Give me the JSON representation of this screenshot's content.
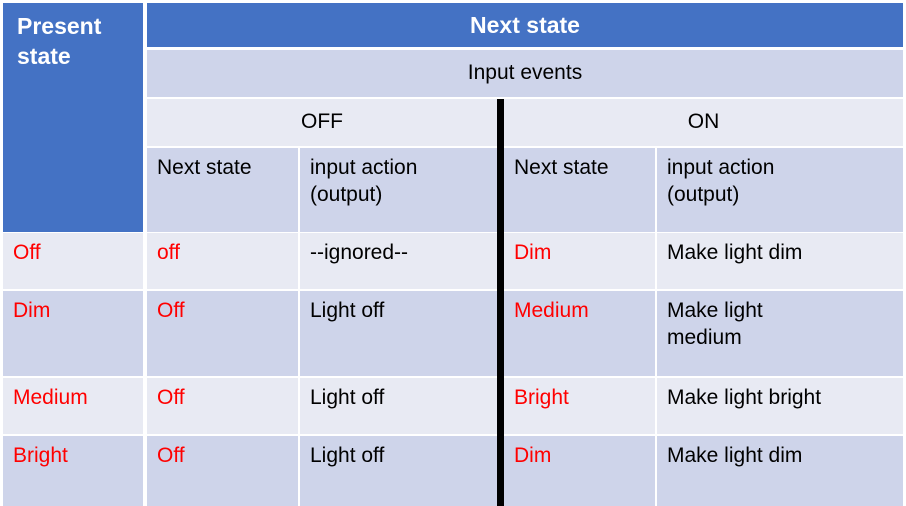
{
  "table": {
    "present_state_header": "Present\nstate",
    "next_state_banner": "Next state",
    "input_events_label": "Input events",
    "groups": [
      {
        "label": "OFF"
      },
      {
        "label": "ON"
      }
    ],
    "sub_headers": {
      "off_next_state": "Next state",
      "off_input_action": "input action\n(output)",
      "on_next_state": "Next state",
      "on_input_action": "input action\n(output)"
    },
    "rows": [
      {
        "present_state": "Off",
        "off_next_state": "off",
        "off_action": "--ignored--",
        "on_next_state": "Dim",
        "on_action": "Make light dim"
      },
      {
        "present_state": "Dim",
        "off_next_state": "Off",
        "off_action": "Light off",
        "on_next_state": "Medium",
        "on_action": "Make light\nmedium"
      },
      {
        "present_state": "Medium",
        "off_next_state": "Off",
        "off_action": "Light off",
        "on_next_state": "Bright",
        "on_action": "Make light bright"
      },
      {
        "present_state": "Bright",
        "off_next_state": "Off",
        "off_action": "Light off",
        "on_next_state": "Dim",
        "on_action": "Make light dim"
      }
    ]
  },
  "colors": {
    "header_blue": "#4472C4",
    "row_light": "#E8EAF3",
    "row_dark": "#CED4EA",
    "state_text_red": "#FF0000",
    "divider_black": "#000000",
    "body_text": "#000000",
    "header_text": "#FFFFFF"
  }
}
